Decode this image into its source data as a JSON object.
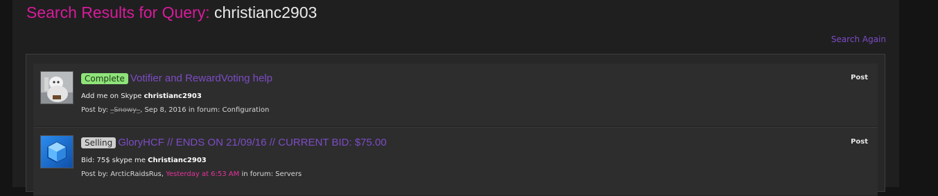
{
  "header": {
    "title_prefix": "Search Results for Query:",
    "query": "christianc2903",
    "search_again": "Search Again"
  },
  "results": [
    {
      "status": "Complete",
      "title": "Votifier and RewardVoting help",
      "snippet_prefix": "Add me on Skype ",
      "snippet_bold": "christianc2903",
      "meta_prefix": "Post by: ",
      "author": "_Snowy_",
      "date": "Sep 8, 2016",
      "meta_suffix": " in forum: Configuration",
      "kind": "Post",
      "avatar_icon": "snow-character-avatar-icon"
    },
    {
      "status": "Selling",
      "title": "GloryHCF // ENDS ON 21/09/16 // CURRENT BID: $75.00",
      "snippet_prefix": "Bid: 75$ skype me ",
      "snippet_bold": "Christianc2903",
      "meta_prefix": "Post by: ",
      "author": "ArcticRaidsRus",
      "date": "Yesterday at 6:53 AM",
      "meta_suffix": " in forum: Servers",
      "kind": "Post",
      "avatar_icon": "blue-cube-avatar-icon"
    }
  ],
  "colors": {
    "accent_pink": "#d81b9b",
    "link_purple": "#7d4cc6",
    "complete_badge": "#8fe37a",
    "selling_badge": "#cfcfcf"
  }
}
